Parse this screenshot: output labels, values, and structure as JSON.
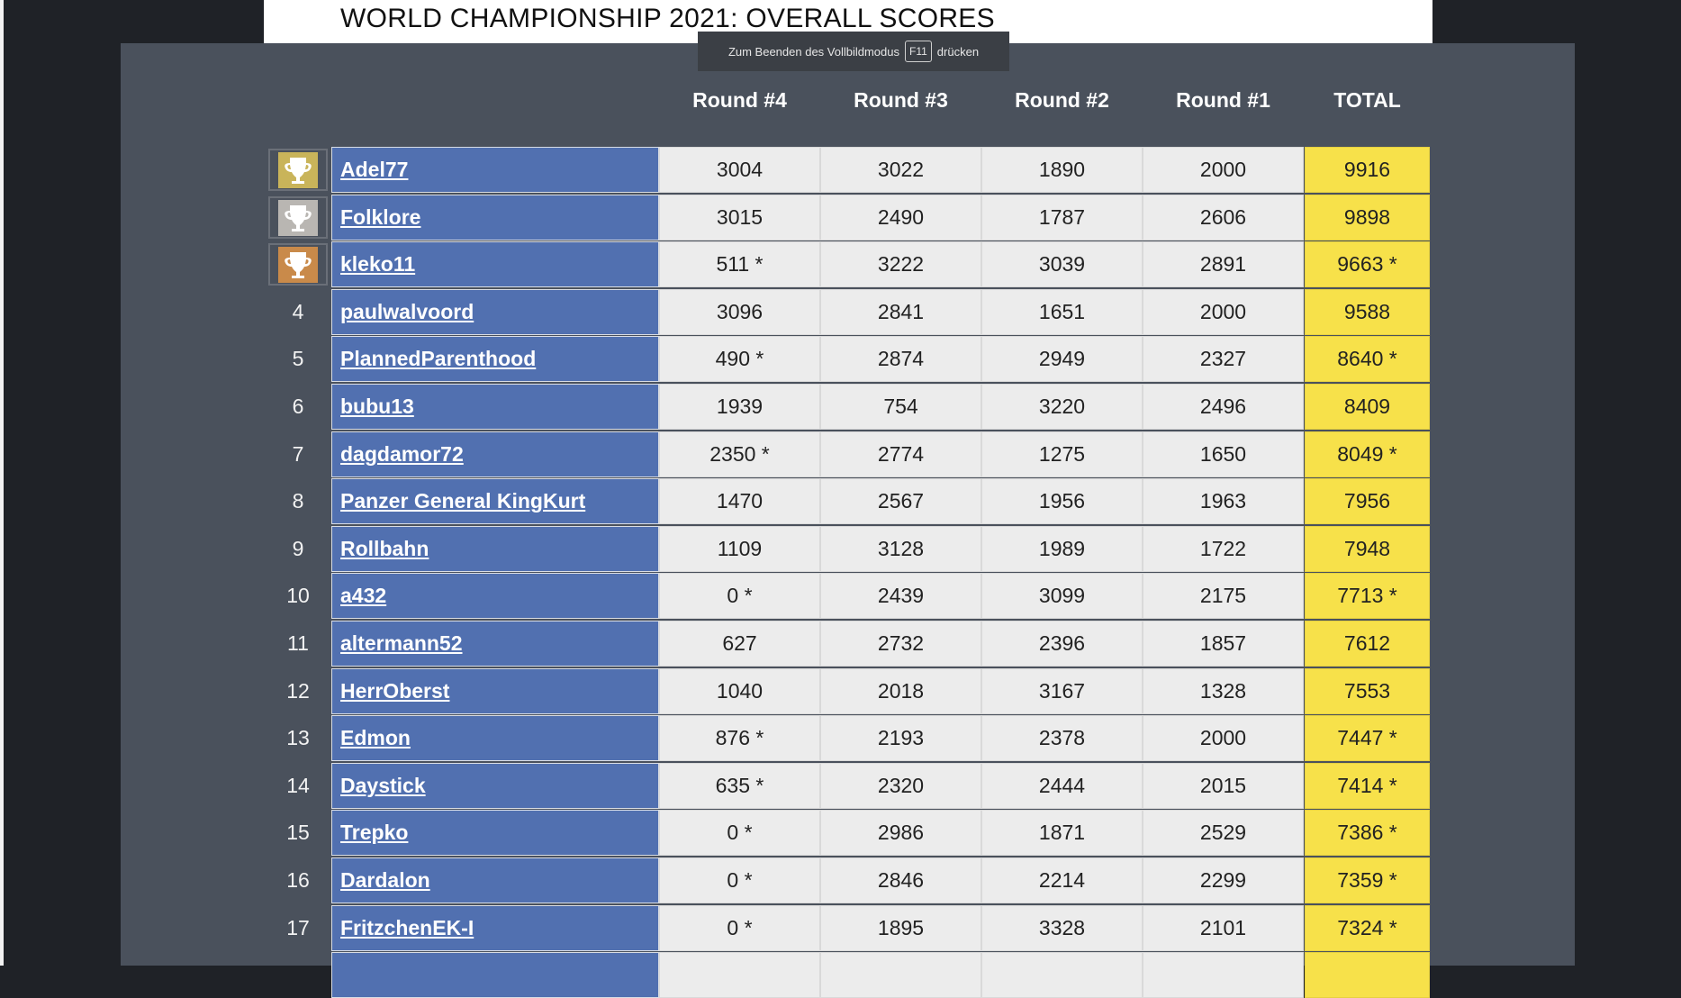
{
  "page": {
    "title": "WORLD CHAMPIONSHIP 2021: OVERALL SCORES",
    "fullscreen_notice": {
      "before": "Zum Beenden des Vollbildmodus",
      "key": "F11",
      "after": "drücken"
    }
  },
  "table": {
    "headers": [
      "Round #4",
      "Round #3",
      "Round #2",
      "Round #1",
      "TOTAL"
    ],
    "rows": [
      {
        "rank": "1",
        "name": "Adel77",
        "r4": "3004",
        "r3": "3022",
        "r2": "1890",
        "r1": "2000",
        "total": "9916"
      },
      {
        "rank": "2",
        "name": "Folklore",
        "r4": "3015",
        "r3": "2490",
        "r2": "1787",
        "r1": "2606",
        "total": "9898"
      },
      {
        "rank": "3",
        "name": "kleko11",
        "r4": "511 *",
        "r3": "3222",
        "r2": "3039",
        "r1": "2891",
        "total": "9663 *"
      },
      {
        "rank": "4",
        "name": "paulwalvoord",
        "r4": "3096",
        "r3": "2841",
        "r2": "1651",
        "r1": "2000",
        "total": "9588"
      },
      {
        "rank": "5",
        "name": "PlannedParenthood",
        "r4": "490 *",
        "r3": "2874",
        "r2": "2949",
        "r1": "2327",
        "total": "8640 *"
      },
      {
        "rank": "6",
        "name": "bubu13",
        "r4": "1939",
        "r3": "754",
        "r2": "3220",
        "r1": "2496",
        "total": "8409"
      },
      {
        "rank": "7",
        "name": "dagdamor72",
        "r4": "2350 *",
        "r3": "2774",
        "r2": "1275",
        "r1": "1650",
        "total": "8049 *"
      },
      {
        "rank": "8",
        "name": "Panzer General KingKurt",
        "r4": "1470",
        "r3": "2567",
        "r2": "1956",
        "r1": "1963",
        "total": "7956"
      },
      {
        "rank": "9",
        "name": "Rollbahn",
        "r4": "1109",
        "r3": "3128",
        "r2": "1989",
        "r1": "1722",
        "total": "7948"
      },
      {
        "rank": "10",
        "name": "a432",
        "r4": "0 *",
        "r3": "2439",
        "r2": "3099",
        "r1": "2175",
        "total": "7713 *"
      },
      {
        "rank": "11",
        "name": "altermann52",
        "r4": "627",
        "r3": "2732",
        "r2": "2396",
        "r1": "1857",
        "total": "7612"
      },
      {
        "rank": "12",
        "name": "HerrOberst",
        "r4": "1040",
        "r3": "2018",
        "r2": "3167",
        "r1": "1328",
        "total": "7553"
      },
      {
        "rank": "13",
        "name": "Edmon",
        "r4": "876 *",
        "r3": "2193",
        "r2": "2378",
        "r1": "2000",
        "total": "7447 *"
      },
      {
        "rank": "14",
        "name": "Daystick",
        "r4": "635 *",
        "r3": "2320",
        "r2": "2444",
        "r1": "2015",
        "total": "7414 *"
      },
      {
        "rank": "15",
        "name": "Trepko",
        "r4": "0 *",
        "r3": "2986",
        "r2": "1871",
        "r1": "2529",
        "total": "7386 *"
      },
      {
        "rank": "16",
        "name": "Dardalon",
        "r4": "0 *",
        "r3": "2846",
        "r2": "2214",
        "r1": "2299",
        "total": "7359 *"
      },
      {
        "rank": "17",
        "name": "FritzchenEK-I",
        "r4": "0 *",
        "r3": "1895",
        "r2": "3328",
        "r1": "2101",
        "total": "7324 *"
      },
      {
        "rank": "",
        "name": "",
        "r4": "",
        "r3": "",
        "r2": "",
        "r1": "",
        "total": ""
      }
    ]
  },
  "colors": {
    "panel": "#4a515c",
    "name_cell": "#5170b0",
    "score_cell": "#ececec",
    "total_cell": "#f7e14a",
    "trophy_gold": "#c9b45a",
    "trophy_silver": "#b9b6b2",
    "trophy_bronze": "#c98a4a"
  },
  "icons": {
    "rank_1": "trophy-gold-icon",
    "rank_2": "trophy-silver-icon",
    "rank_3": "trophy-bronze-icon"
  }
}
